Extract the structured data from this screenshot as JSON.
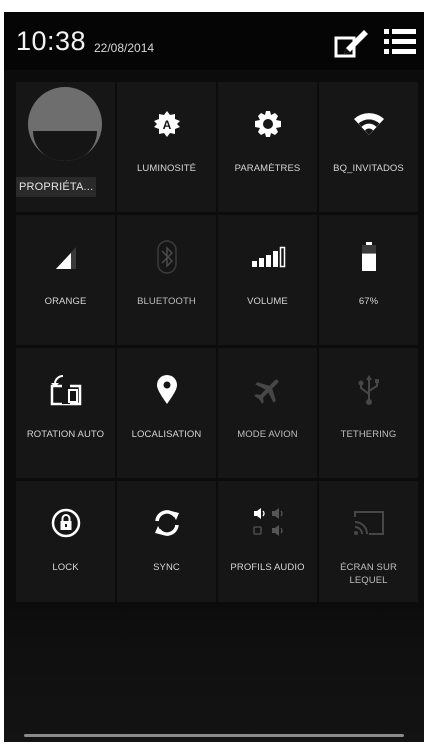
{
  "status_bar": {
    "time": "10:38",
    "date": "22/08/2014",
    "edit_icon": "edit-pencil-icon",
    "list_icon": "list-icon"
  },
  "profile": {
    "label": "PROPRIÉTA..."
  },
  "tiles": [
    {
      "label": "LUMINOSITÉ",
      "icon": "brightness-auto-icon"
    },
    {
      "label": "PARAMÈTRES",
      "icon": "settings-gear-icon"
    },
    {
      "label": "BQ_INVITADOS",
      "icon": "wifi-icon"
    },
    {
      "label": "ORANGE",
      "icon": "cell-signal-icon"
    },
    {
      "label": "BLUETOOTH",
      "icon": "bluetooth-icon"
    },
    {
      "label": "VOLUME",
      "icon": "volume-bars-icon"
    },
    {
      "label": "67%",
      "icon": "battery-icon"
    },
    {
      "label": "ROTATION AUTO",
      "icon": "rotation-icon"
    },
    {
      "label": "LOCALISATION",
      "icon": "location-pin-icon"
    },
    {
      "label": "MODE AVION",
      "icon": "airplane-icon"
    },
    {
      "label": "TETHERING",
      "icon": "usb-icon"
    },
    {
      "label": "LOCK",
      "icon": "lock-icon"
    },
    {
      "label": "SYNC",
      "icon": "sync-icon"
    },
    {
      "label": "PROFILS AUDIO",
      "icon": "audio-profiles-icon"
    },
    {
      "label": "ÉCRAN SUR LEQUEL",
      "icon": "cast-screen-icon"
    }
  ],
  "battery_level": 0.67
}
